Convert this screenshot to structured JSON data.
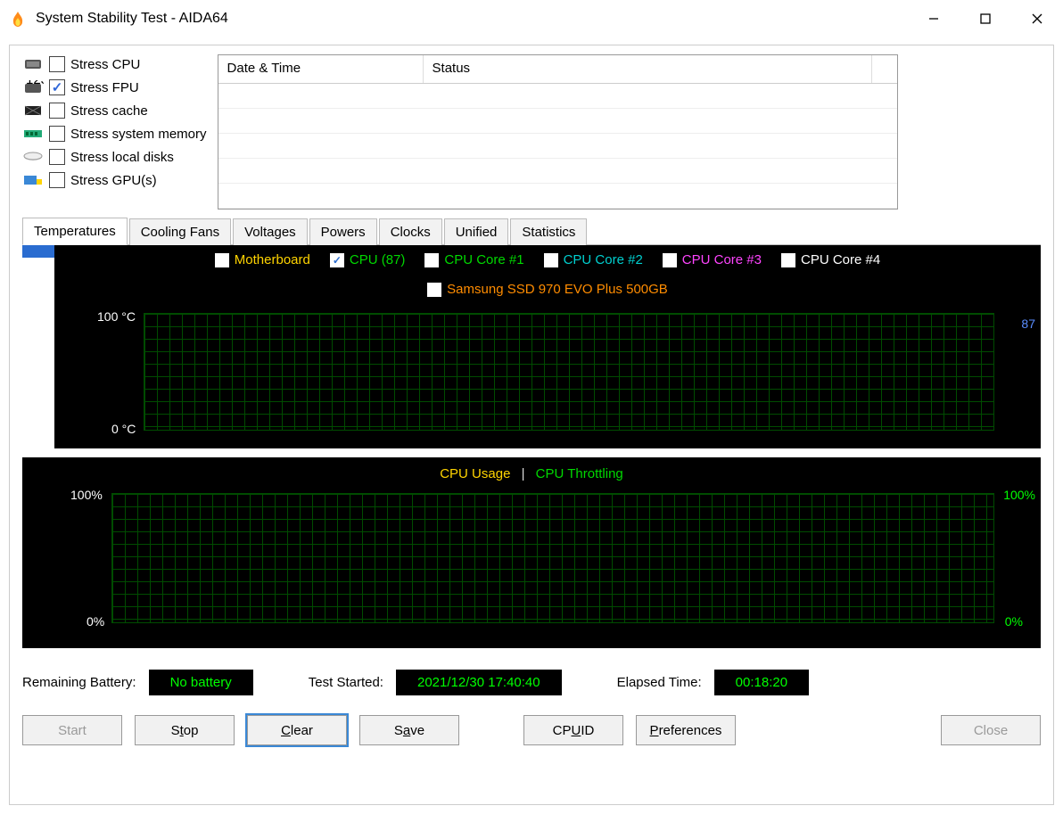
{
  "window": {
    "title": "System Stability Test - AIDA64"
  },
  "stress": {
    "items": [
      {
        "label": "Stress CPU",
        "checked": false
      },
      {
        "label": "Stress FPU",
        "checked": true
      },
      {
        "label": "Stress cache",
        "checked": false
      },
      {
        "label": "Stress system memory",
        "checked": false
      },
      {
        "label": "Stress local disks",
        "checked": false
      },
      {
        "label": "Stress GPU(s)",
        "checked": false
      }
    ]
  },
  "log": {
    "col_date": "Date & Time",
    "col_status": "Status"
  },
  "tabs": [
    "Temperatures",
    "Cooling Fans",
    "Voltages",
    "Powers",
    "Clocks",
    "Unified",
    "Statistics"
  ],
  "temp_series": {
    "mb": "Motherboard",
    "cpu": "CPU (87)",
    "c1": "CPU Core #1",
    "c2": "CPU Core #2",
    "c3": "CPU Core #3",
    "c4": "CPU Core #4",
    "ssd": "Samsung SSD 970 EVO Plus 500GB",
    "cpu_checked": true
  },
  "temp_axis": {
    "top": "100 °C",
    "bottom": "0 °C",
    "right_marker": "87"
  },
  "usage": {
    "title_usage": "CPU Usage",
    "title_throttle": "CPU Throttling",
    "ltop": "100%",
    "lbot": "0%",
    "rtop": "100%",
    "rbot": "0%"
  },
  "status": {
    "batt_lbl": "Remaining Battery:",
    "batt_val": "No battery",
    "start_lbl": "Test Started:",
    "start_val": "2021/12/30 17:40:40",
    "elapsed_lbl": "Elapsed Time:",
    "elapsed_val": "00:18:20"
  },
  "buttons": {
    "start": "Start",
    "stop": "Stop",
    "clear": "Clear",
    "save": "Save",
    "cpuid": "CPUID",
    "prefs": "Preferences",
    "close": "Close"
  },
  "chart_data": [
    {
      "type": "line",
      "title": "Temperatures",
      "ylabel": "°C",
      "ylim": [
        0,
        100
      ],
      "series": [
        {
          "name": "Motherboard",
          "color": "#ffd400",
          "values": []
        },
        {
          "name": "CPU",
          "color": "#00d800",
          "values": [
            87
          ]
        },
        {
          "name": "CPU Core #1",
          "color": "#00d800",
          "values": []
        },
        {
          "name": "CPU Core #2",
          "color": "#00cfcf",
          "values": []
        },
        {
          "name": "CPU Core #3",
          "color": "#ff44ff",
          "values": []
        },
        {
          "name": "CPU Core #4",
          "color": "#ffffff",
          "values": []
        },
        {
          "name": "Samsung SSD 970 EVO Plus 500GB",
          "color": "#ff8c00",
          "values": []
        }
      ],
      "right_markers": [
        {
          "value": 87,
          "color": "#5a8dff"
        }
      ]
    },
    {
      "type": "line",
      "title": "CPU Usage / Throttling",
      "ylabel_left": "%",
      "ylabel_right": "%",
      "ylim": [
        0,
        100
      ],
      "series": [
        {
          "name": "CPU Usage",
          "color": "#ffd400",
          "values": []
        },
        {
          "name": "CPU Throttling",
          "color": "#00d800",
          "values": []
        }
      ]
    }
  ]
}
